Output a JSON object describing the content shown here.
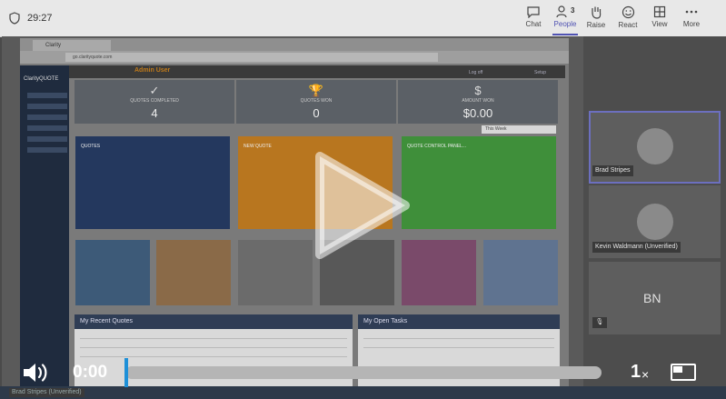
{
  "meeting": {
    "timer": "29:27"
  },
  "toolbar": {
    "items": [
      {
        "label": "Chat",
        "icon": "chat-icon"
      },
      {
        "label": "People",
        "icon": "people-icon",
        "badge": "3",
        "active": true
      },
      {
        "label": "Raise",
        "icon": "raise-hand-icon"
      },
      {
        "label": "React",
        "icon": "react-icon"
      },
      {
        "label": "View",
        "icon": "view-icon"
      },
      {
        "label": "More",
        "icon": "more-icon"
      }
    ]
  },
  "shared_screen": {
    "tab_title": "Clarity",
    "url": "go.clarityquote.com",
    "app_name": "ClarityQUOTE",
    "header": {
      "title": "Admin User",
      "log_off": "Log off",
      "setup": "Setup"
    },
    "stats": [
      {
        "icon": "✓",
        "label": "QUOTES COMPLETED",
        "value": "4"
      },
      {
        "icon": "🏆",
        "label": "QUOTES WON",
        "value": "0"
      },
      {
        "icon": "$",
        "label": "AMOUNT WON",
        "value": "$0.00"
      }
    ],
    "filter": "This Week",
    "tiles": [
      "QUOTES",
      "NEW QUOTE",
      "QUOTE CONTROL PANEL..."
    ],
    "panels": {
      "quotes": "My Recent Quotes",
      "tasks": "My Open Tasks"
    }
  },
  "participants": [
    {
      "name": "Brad Stripes",
      "initials": ""
    },
    {
      "name": "Kevin Waldmann (Unverified)",
      "initials": ""
    },
    {
      "name": "",
      "initials": "BN"
    }
  ],
  "screen_share_label": "Brad Stripes (Unverified)",
  "player": {
    "current_time": "0:00",
    "progress": 0.0,
    "speed": "1",
    "speed_suffix": "×"
  },
  "colors": {
    "accent": "#4f52b2",
    "progress": "#1e90d8",
    "orange_tile": "#b8761f",
    "green_tile": "#3f8f3a",
    "blue_tile": "#24385e"
  }
}
